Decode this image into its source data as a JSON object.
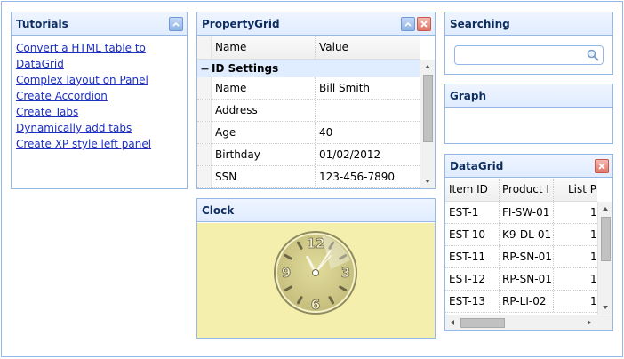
{
  "tutorials": {
    "title": "Tutorials",
    "links": [
      "Convert a HTML table to DataGrid",
      "Complex layout on Panel",
      "Create Accordion",
      "Create Tabs",
      "Dynamically add tabs",
      "Create XP style left panel"
    ]
  },
  "propertygrid": {
    "title": "PropertyGrid",
    "columns": [
      "Name",
      "Value"
    ],
    "group": "ID Settings",
    "rows": [
      {
        "name": "Name",
        "value": "Bill Smith"
      },
      {
        "name": "Address",
        "value": ""
      },
      {
        "name": "Age",
        "value": "40"
      },
      {
        "name": "Birthday",
        "value": "01/02/2012"
      },
      {
        "name": "SSN",
        "value": "123-456-7890"
      }
    ]
  },
  "searching": {
    "title": "Searching",
    "value": ""
  },
  "graph": {
    "title": "Graph"
  },
  "clock": {
    "title": "Clock",
    "numerals": [
      "12",
      "3",
      "6",
      "9"
    ],
    "time": {
      "hour": 11,
      "minute": 5,
      "second": 37
    }
  },
  "datagrid": {
    "title": "DataGrid",
    "columns": [
      "Item ID",
      "Product I",
      "List Price"
    ],
    "rows": [
      {
        "item": "EST-1",
        "product": "FI-SW-01",
        "price": "1"
      },
      {
        "item": "EST-10",
        "product": "K9-DL-01",
        "price": "1"
      },
      {
        "item": "EST-11",
        "product": "RP-SN-01",
        "price": "1"
      },
      {
        "item": "EST-12",
        "product": "RP-SN-01",
        "price": "1"
      },
      {
        "item": "EST-13",
        "product": "RP-LI-02",
        "price": "1"
      }
    ]
  },
  "colors": {
    "border": "#95b8e7",
    "title": "#0e2d5f",
    "link": "#1c2fbf",
    "clock_bg": "#f4efad",
    "group_bg": "#e0ecff"
  }
}
